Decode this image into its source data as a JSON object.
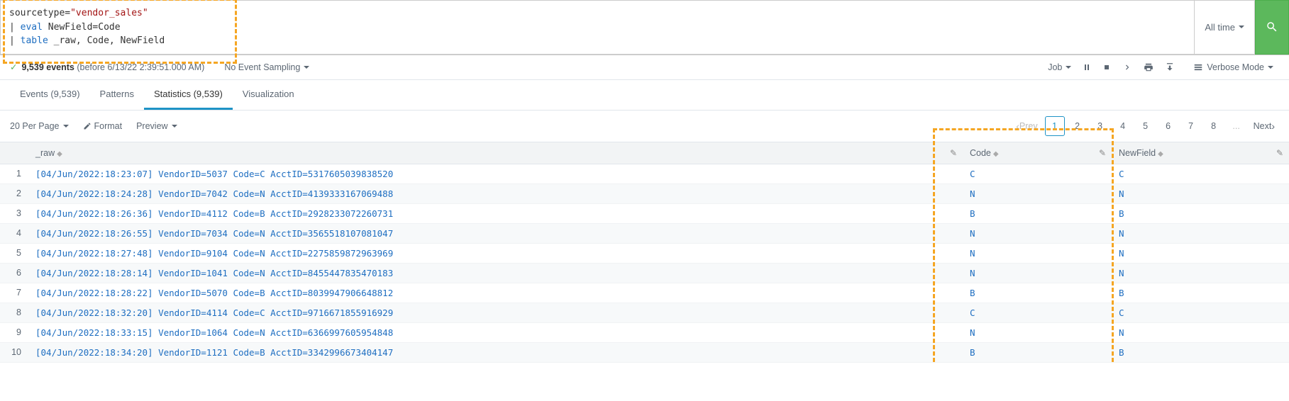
{
  "search": {
    "line1_key": "sourcetype",
    "line1_val": "\"vendor_sales\"",
    "line2_cmd": "eval",
    "line2_expr": "NewField=Code",
    "line3_cmd": "table",
    "line3_expr": "_raw, Code, NewField"
  },
  "time_picker": "All time",
  "event_bar": {
    "count_text": "9,539 events",
    "range_text": "(before 6/13/22 2:39:51.000 AM)",
    "sampling": "No Event Sampling",
    "job": "Job",
    "mode": "Verbose Mode"
  },
  "tabs": {
    "events": "Events (9,539)",
    "patterns": "Patterns",
    "statistics": "Statistics (9,539)",
    "visualization": "Visualization"
  },
  "toolbar": {
    "per_page": "20 Per Page",
    "format": "Format",
    "preview": "Preview",
    "prev": "Prev",
    "next": "Next",
    "pages": [
      "1",
      "2",
      "3",
      "4",
      "5",
      "6",
      "7",
      "8"
    ],
    "ellipsis": "..."
  },
  "columns": {
    "raw": "_raw",
    "code": "Code",
    "newfield": "NewField"
  },
  "rows": [
    {
      "n": "1",
      "raw": "[04/Jun/2022:18:23:07] VendorID=5037 Code=C AcctID=5317605039838520",
      "code": "C",
      "nf": "C"
    },
    {
      "n": "2",
      "raw": "[04/Jun/2022:18:24:28] VendorID=7042 Code=N AcctID=4139333167069488",
      "code": "N",
      "nf": "N"
    },
    {
      "n": "3",
      "raw": "[04/Jun/2022:18:26:36] VendorID=4112 Code=B AcctID=2928233072260731",
      "code": "B",
      "nf": "B"
    },
    {
      "n": "4",
      "raw": "[04/Jun/2022:18:26:55] VendorID=7034 Code=N AcctID=3565518107081047",
      "code": "N",
      "nf": "N"
    },
    {
      "n": "5",
      "raw": "[04/Jun/2022:18:27:48] VendorID=9104 Code=N AcctID=2275859872963969",
      "code": "N",
      "nf": "N"
    },
    {
      "n": "6",
      "raw": "[04/Jun/2022:18:28:14] VendorID=1041 Code=N AcctID=8455447835470183",
      "code": "N",
      "nf": "N"
    },
    {
      "n": "7",
      "raw": "[04/Jun/2022:18:28:22] VendorID=5070 Code=B AcctID=8039947906648812",
      "code": "B",
      "nf": "B"
    },
    {
      "n": "8",
      "raw": "[04/Jun/2022:18:32:20] VendorID=4114 Code=C AcctID=9716671855916929",
      "code": "C",
      "nf": "C"
    },
    {
      "n": "9",
      "raw": "[04/Jun/2022:18:33:15] VendorID=1064 Code=N AcctID=6366997605954848",
      "code": "N",
      "nf": "N"
    },
    {
      "n": "10",
      "raw": "[04/Jun/2022:18:34:20] VendorID=1121 Code=B AcctID=3342996673404147",
      "code": "B",
      "nf": "B"
    }
  ]
}
